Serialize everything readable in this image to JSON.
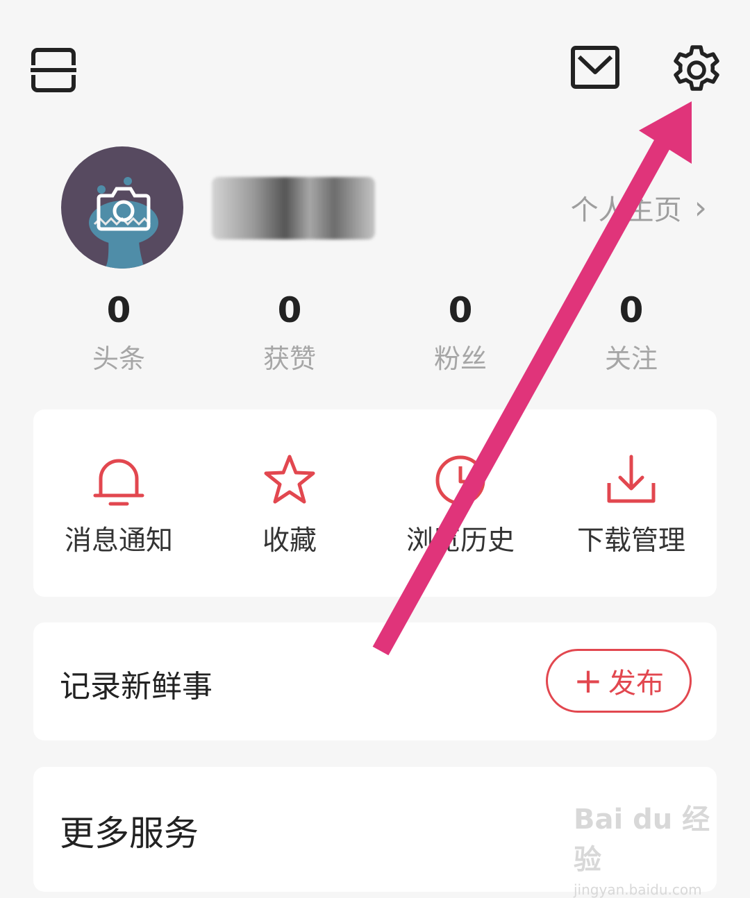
{
  "header": {
    "scan_icon": "scan-icon",
    "mail_icon": "mail-icon",
    "settings_icon": "gear-icon"
  },
  "profile": {
    "link_label": "个人主页",
    "link_chevron": "›"
  },
  "stats": [
    {
      "value": "0",
      "label": "头条"
    },
    {
      "value": "0",
      "label": "获赞"
    },
    {
      "value": "0",
      "label": "粉丝"
    },
    {
      "value": "0",
      "label": "关注"
    }
  ],
  "quick_actions": [
    {
      "label": "消息通知",
      "icon": "bell-icon"
    },
    {
      "label": "收藏",
      "icon": "star-icon"
    },
    {
      "label": "浏览历史",
      "icon": "clock-icon"
    },
    {
      "label": "下载管理",
      "icon": "download-icon"
    }
  ],
  "record": {
    "title": "记录新鲜事",
    "publish_plus": "+",
    "publish_label": "发布"
  },
  "more": {
    "title": "更多服务"
  },
  "watermark": {
    "brand": "Bai du 经验",
    "url": "jingyan.baidu.com"
  },
  "colors": {
    "accent": "#e2474f",
    "annotation_arrow": "#e0347a",
    "background": "#f6f6f6"
  }
}
